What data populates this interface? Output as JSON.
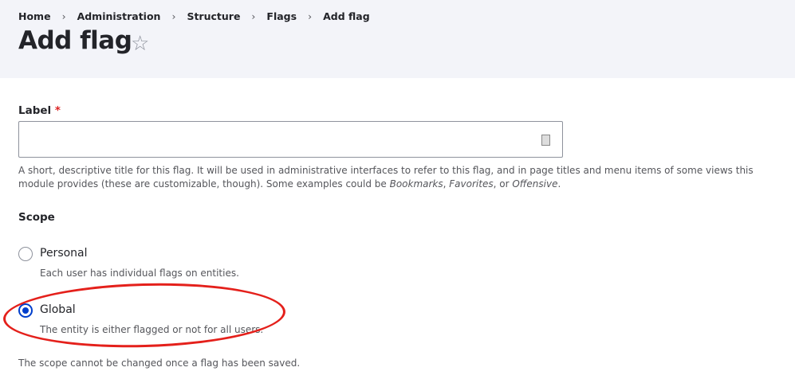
{
  "breadcrumb": [
    "Home",
    "Administration",
    "Structure",
    "Flags",
    "Add flag"
  ],
  "page_title": "Add flag",
  "label_field": {
    "label": "Label",
    "required_mark": "*",
    "value": "",
    "description_parts": [
      "A short, descriptive title for this flag. It will be used in administrative interfaces to refer to this flag, and in page titles and menu items of some views this module provides (these are customizable, though). Some examples could be ",
      "Bookmarks",
      ", ",
      "Favorites",
      ", or ",
      "Offensive",
      "."
    ]
  },
  "scope": {
    "label": "Scope",
    "options": [
      {
        "label": "Personal",
        "description": "Each user has individual flags on entities.",
        "selected": false
      },
      {
        "label": "Global",
        "description": "The entity is either flagged or not for all users.",
        "selected": true
      }
    ],
    "note": "The scope cannot be changed once a flag has been saved."
  }
}
